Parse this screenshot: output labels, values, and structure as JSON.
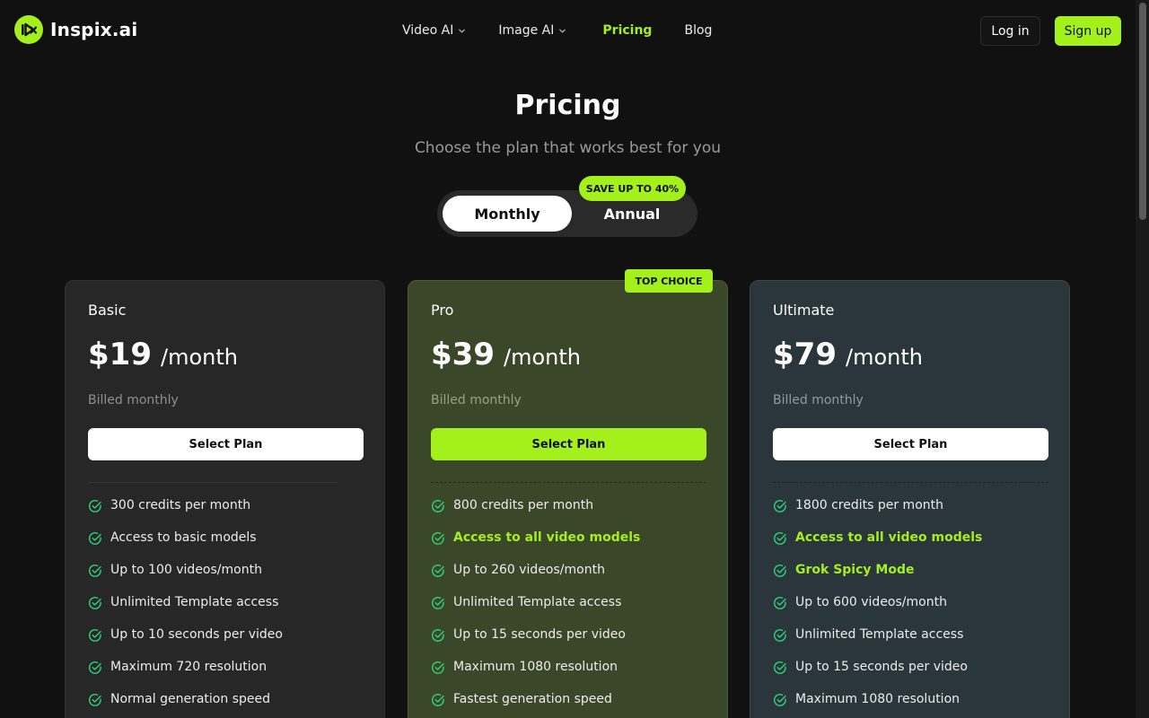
{
  "brand": {
    "name": "Inspix.ai",
    "accent": "#a4f01a",
    "logo_icon": "play-x-logo-icon"
  },
  "nav": {
    "items": [
      {
        "label": "Video AI",
        "dropdown": true
      },
      {
        "label": "Image AI",
        "dropdown": true
      },
      {
        "label": "Pricing",
        "active": true
      },
      {
        "label": "Blog"
      }
    ]
  },
  "auth": {
    "login_label": "Log in",
    "signup_label": "Sign up"
  },
  "hero": {
    "title": "Pricing",
    "subtitle": "Choose the plan that works best for you"
  },
  "billing_toggle": {
    "monthly_label": "Monthly",
    "annual_label": "Annual",
    "selected": "Monthly",
    "save_badge": "SAVE UP TO 40%"
  },
  "plans": [
    {
      "name": "Basic",
      "price": "$19",
      "period": "/month",
      "billing": "Billed monthly",
      "button_label": "Select Plan",
      "features": [
        {
          "text": "300 credits per month"
        },
        {
          "text": "Access to basic models"
        },
        {
          "text": "Up to 100 videos/month"
        },
        {
          "text": "Unlimited Template access"
        },
        {
          "text": "Up to 10 seconds per video"
        },
        {
          "text": "Maximum 720 resolution"
        },
        {
          "text": "Normal generation speed"
        }
      ]
    },
    {
      "name": "Pro",
      "badge": "TOP CHOICE",
      "price": "$39",
      "period": "/month",
      "billing": "Billed monthly",
      "button_label": "Select Plan",
      "features": [
        {
          "text": "800 credits per month"
        },
        {
          "text": "Access to all video models",
          "highlight": true
        },
        {
          "text": "Up to 260 videos/month"
        },
        {
          "text": "Unlimited Template access"
        },
        {
          "text": "Up to 15 seconds per video"
        },
        {
          "text": "Maximum 1080 resolution"
        },
        {
          "text": "Fastest generation speed"
        }
      ]
    },
    {
      "name": "Ultimate",
      "price": "$79",
      "period": "/month",
      "billing": "Billed monthly",
      "button_label": "Select Plan",
      "features": [
        {
          "text": "1800 credits per month"
        },
        {
          "text": "Access to all video models",
          "highlight": true
        },
        {
          "text": "Grok Spicy Mode",
          "highlight": true
        },
        {
          "text": "Up to 600 videos/month"
        },
        {
          "text": "Unlimited Template access"
        },
        {
          "text": "Up to 15 seconds per video"
        },
        {
          "text": "Maximum 1080 resolution"
        }
      ]
    }
  ],
  "colors": {
    "check": "#2fd27a",
    "page_bg": "#111111"
  }
}
